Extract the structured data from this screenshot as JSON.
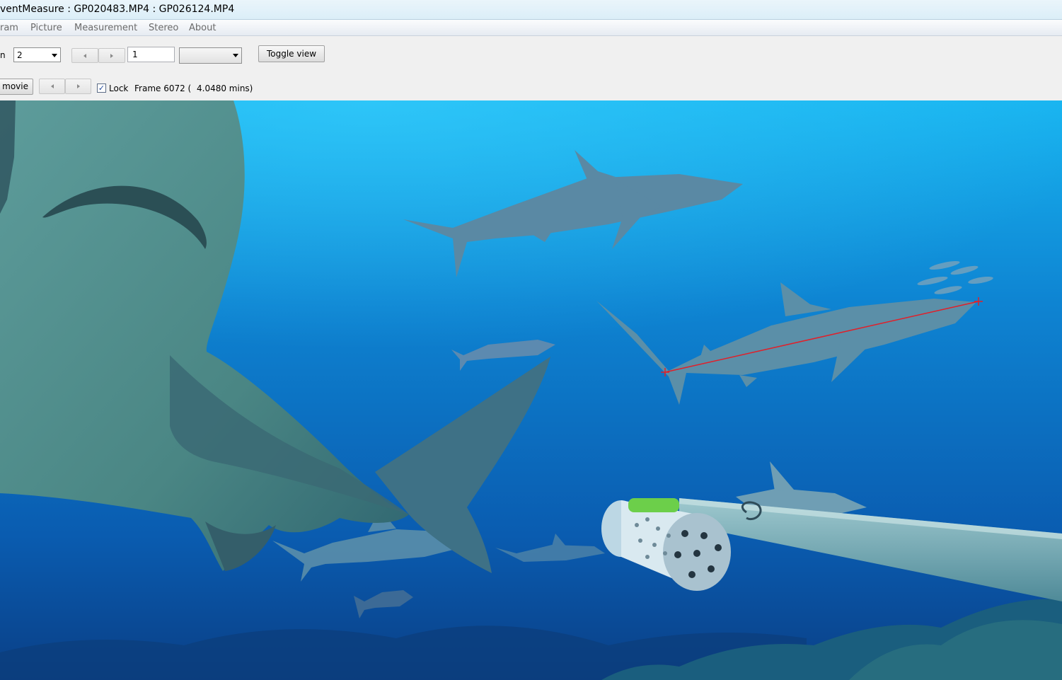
{
  "window": {
    "title": "ventMeasure : GP020483.MP4 : GP026124.MP4"
  },
  "menu": {
    "items": [
      "ram",
      "Picture",
      "Measurement",
      "Stereo",
      "About"
    ]
  },
  "toolbar": {
    "row1_left_fragment": "n",
    "camera_select": {
      "value": "2"
    },
    "frame_step_input": {
      "value": "1"
    },
    "unit_select": {
      "value": ""
    },
    "toggle_view_label": "Toggle view"
  },
  "row2": {
    "movie_button_label": "movie",
    "lock_checkbox": {
      "checked": true,
      "label": "Lock"
    },
    "frame_label": "Frame 6072 (",
    "time_label": "4.0480 mins)"
  },
  "colors": {
    "measurement_line": "#e0202a",
    "water_top": "#1ea8e8",
    "water_deep": "#0b3f8c"
  }
}
